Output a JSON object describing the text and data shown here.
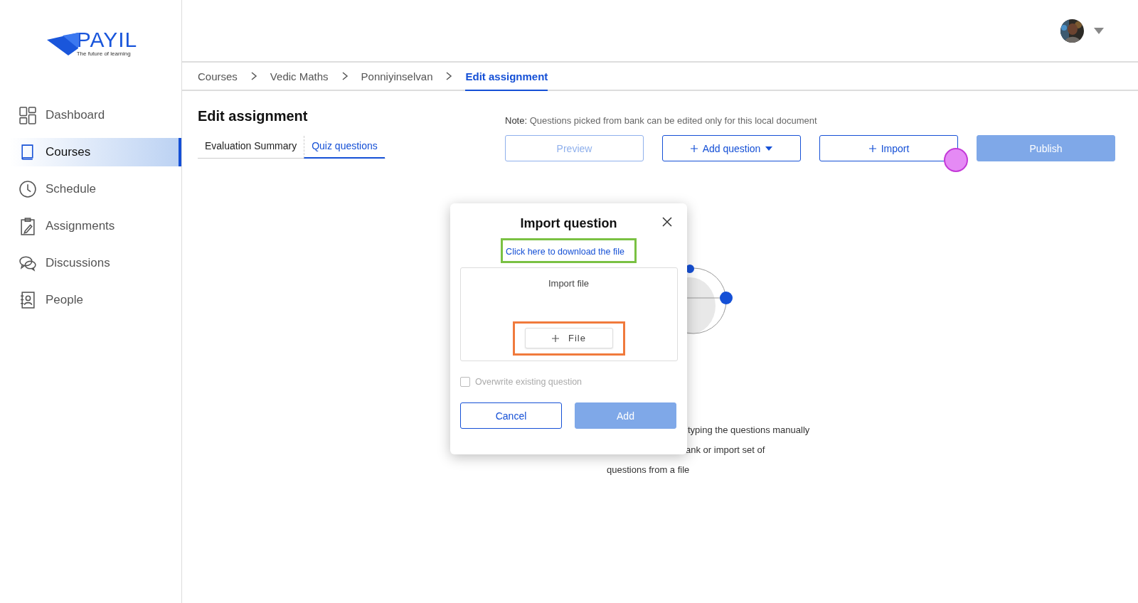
{
  "logo": {
    "name": "PAYIL",
    "tagline": "The future of learning"
  },
  "sidebar": {
    "items": [
      {
        "label": "Dashboard",
        "selected": false
      },
      {
        "label": "Courses",
        "selected": true
      },
      {
        "label": "Schedule",
        "selected": false
      },
      {
        "label": "Assignments",
        "selected": false
      },
      {
        "label": "Discussions",
        "selected": false
      },
      {
        "label": "People",
        "selected": false
      }
    ]
  },
  "breadcrumbs": [
    {
      "label": "Courses",
      "selected": false
    },
    {
      "label": "Vedic Maths",
      "selected": false
    },
    {
      "label": "Ponniyinselvan",
      "selected": false
    },
    {
      "label": "Edit assignment",
      "selected": true
    }
  ],
  "page_title": "Edit assignment",
  "tabs": [
    {
      "label": "Evaluation Summary",
      "selected": false
    },
    {
      "label": "Quiz questions",
      "selected": true
    }
  ],
  "note": {
    "label": "Note:",
    "text": "Questions picked from bank can be edited only for this local document"
  },
  "actions": [
    {
      "label": "Preview",
      "kind": "outline",
      "disabled": true
    },
    {
      "label": "Add question",
      "kind": "outline",
      "disabled": false
    },
    {
      "label": "Import",
      "kind": "outline",
      "disabled": false
    },
    {
      "label": "Publish",
      "kind": "primary",
      "disabled": true
    }
  ],
  "empty_hint": [
    "typing the questions manually",
    "ank or import set of",
    "questions from a file"
  ],
  "dialog": {
    "title": "Import question",
    "download_link": "Click here to download the file",
    "dropzone_label": "Import file",
    "file_button": "File",
    "overwrite": {
      "label": "Overwrite existing question",
      "checked": false,
      "disabled": true
    },
    "buttons": [
      {
        "label": "Cancel",
        "kind": "outline",
        "disabled": false
      },
      {
        "label": "Add",
        "kind": "primary",
        "disabled": true
      }
    ]
  }
}
